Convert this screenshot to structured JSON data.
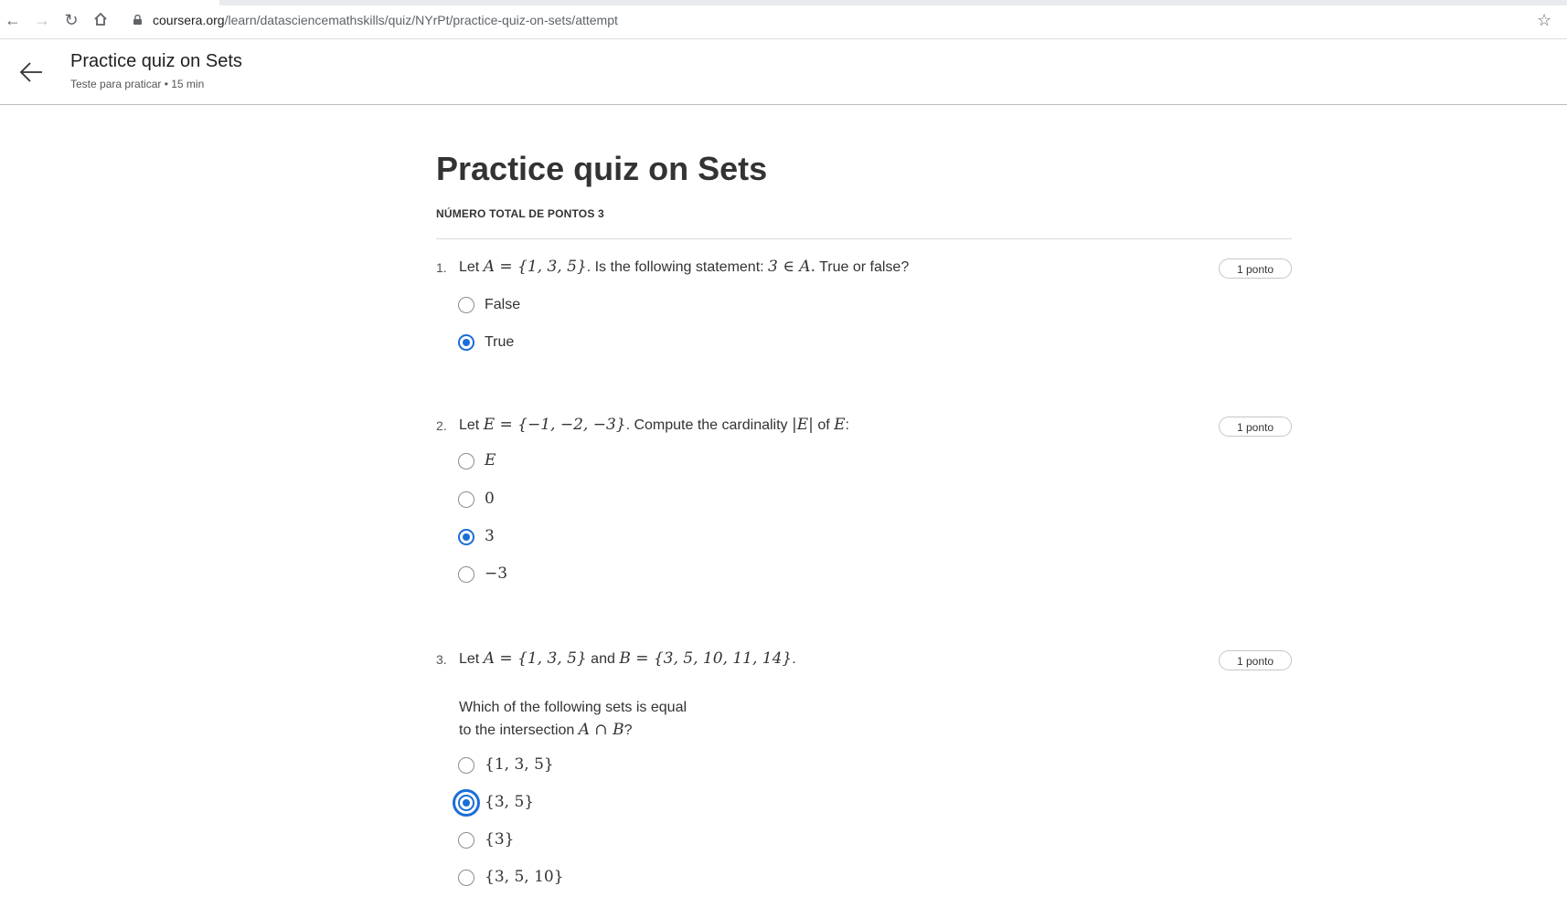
{
  "browser": {
    "url_host": "coursera.org",
    "url_path": "/learn/datasciencemathskills/quiz/NYrPt/practice-quiz-on-sets/attempt",
    "icons": [
      "back-icon",
      "forward-icon",
      "reload-icon",
      "home-icon",
      "lock-icon",
      "star-icon"
    ]
  },
  "header": {
    "title": "Practice quiz on Sets",
    "subtitle": "Teste para praticar • 15 min"
  },
  "quiz": {
    "title": "Practice quiz on Sets",
    "total_points": "NÚMERO TOTAL DE PONTOS 3",
    "questions": [
      {
        "number": "1.",
        "text_parts": [
          "Let ",
          "A = {1, 3, 5}",
          ". Is the following statement:  ",
          "3 ∈ A.",
          "  True or false?"
        ],
        "points": "1 ponto",
        "options": [
          "False",
          "True"
        ],
        "selected": 1
      },
      {
        "number": "2.",
        "text_parts": [
          "Let ",
          "E = {−1, −2, −3}",
          ". Compute the cardinality ",
          "|E|",
          " of ",
          "E",
          ":"
        ],
        "points": "1 ponto",
        "options": [
          "E",
          "0",
          "3",
          "−3"
        ],
        "selected": 2
      },
      {
        "number": "3.",
        "text_parts": [
          "Let ",
          "A = {1, 3, 5}",
          " and ",
          "B = {3, 5, 10, 11, 14}",
          "."
        ],
        "points": "1 ponto",
        "prompt_line1": "Which of the following sets is equal",
        "prompt_line2_parts": [
          "to the intersection ",
          "A ∩ B",
          "?"
        ],
        "options": [
          "{1, 3, 5}",
          "{3, 5}",
          "{3}",
          "{3, 5, 10}"
        ],
        "selected": 1
      }
    ]
  },
  "colors": {
    "accent": "#1a6ed8",
    "text": "#333333",
    "border": "#bdbdbd"
  }
}
